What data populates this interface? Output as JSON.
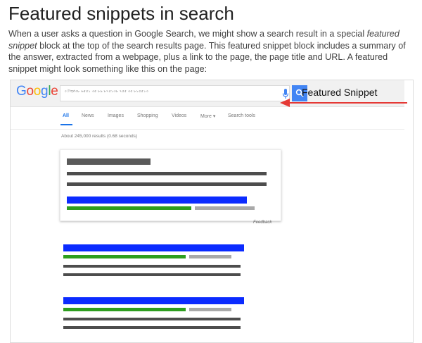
{
  "article": {
    "title": "Featured snippets in search",
    "intro_before": "When a user asks a question in Google Search, we might show a search result in a special ",
    "intro_emphasis": "featured snippet",
    "intro_after": " block at the top of the search results page. This featured snippet block includes a summary of the answer, extracted from a webpage, plus a link to the page, the page title and URL. A featured snippet might look something like this on the page:"
  },
  "serp": {
    "logo_letters": [
      {
        "char": "G",
        "color": "#4285f4"
      },
      {
        "char": "o",
        "color": "#ea4335"
      },
      {
        "char": "o",
        "color": "#fbbc05"
      },
      {
        "char": "g",
        "color": "#4285f4"
      },
      {
        "char": "l",
        "color": "#34a853"
      },
      {
        "char": "e",
        "color": "#ea4335"
      }
    ],
    "search_query": "ৌঢ়ো৩৮ ৬৫৫১ ৩৫ ৮৯ ৮৭৫১৩৮ ৭৫৫ ৩৫ ৮১৫৫১৩",
    "tabs": [
      {
        "label": "All",
        "active": true
      },
      {
        "label": "News",
        "active": false
      },
      {
        "label": "Images",
        "active": false
      },
      {
        "label": "Shopping",
        "active": false
      },
      {
        "label": "Videos",
        "active": false
      },
      {
        "label": "More ▾",
        "active": false
      },
      {
        "label": "Search tools",
        "active": false
      }
    ],
    "results_stats": "About 245,000 results (0.68 seconds)",
    "feedback_label": "Feedback",
    "colors": {
      "title_bar": "#0b2bff",
      "url_bar": "#2e9e1f",
      "snippet_title_bar": "#5a5a5a",
      "cached_bar": "#a9a9a9",
      "text_bar": "#4d4d4d",
      "accent": "#4285f4"
    }
  },
  "callout": {
    "label": "Featured Snippet",
    "arrow_color": "#e53935"
  }
}
